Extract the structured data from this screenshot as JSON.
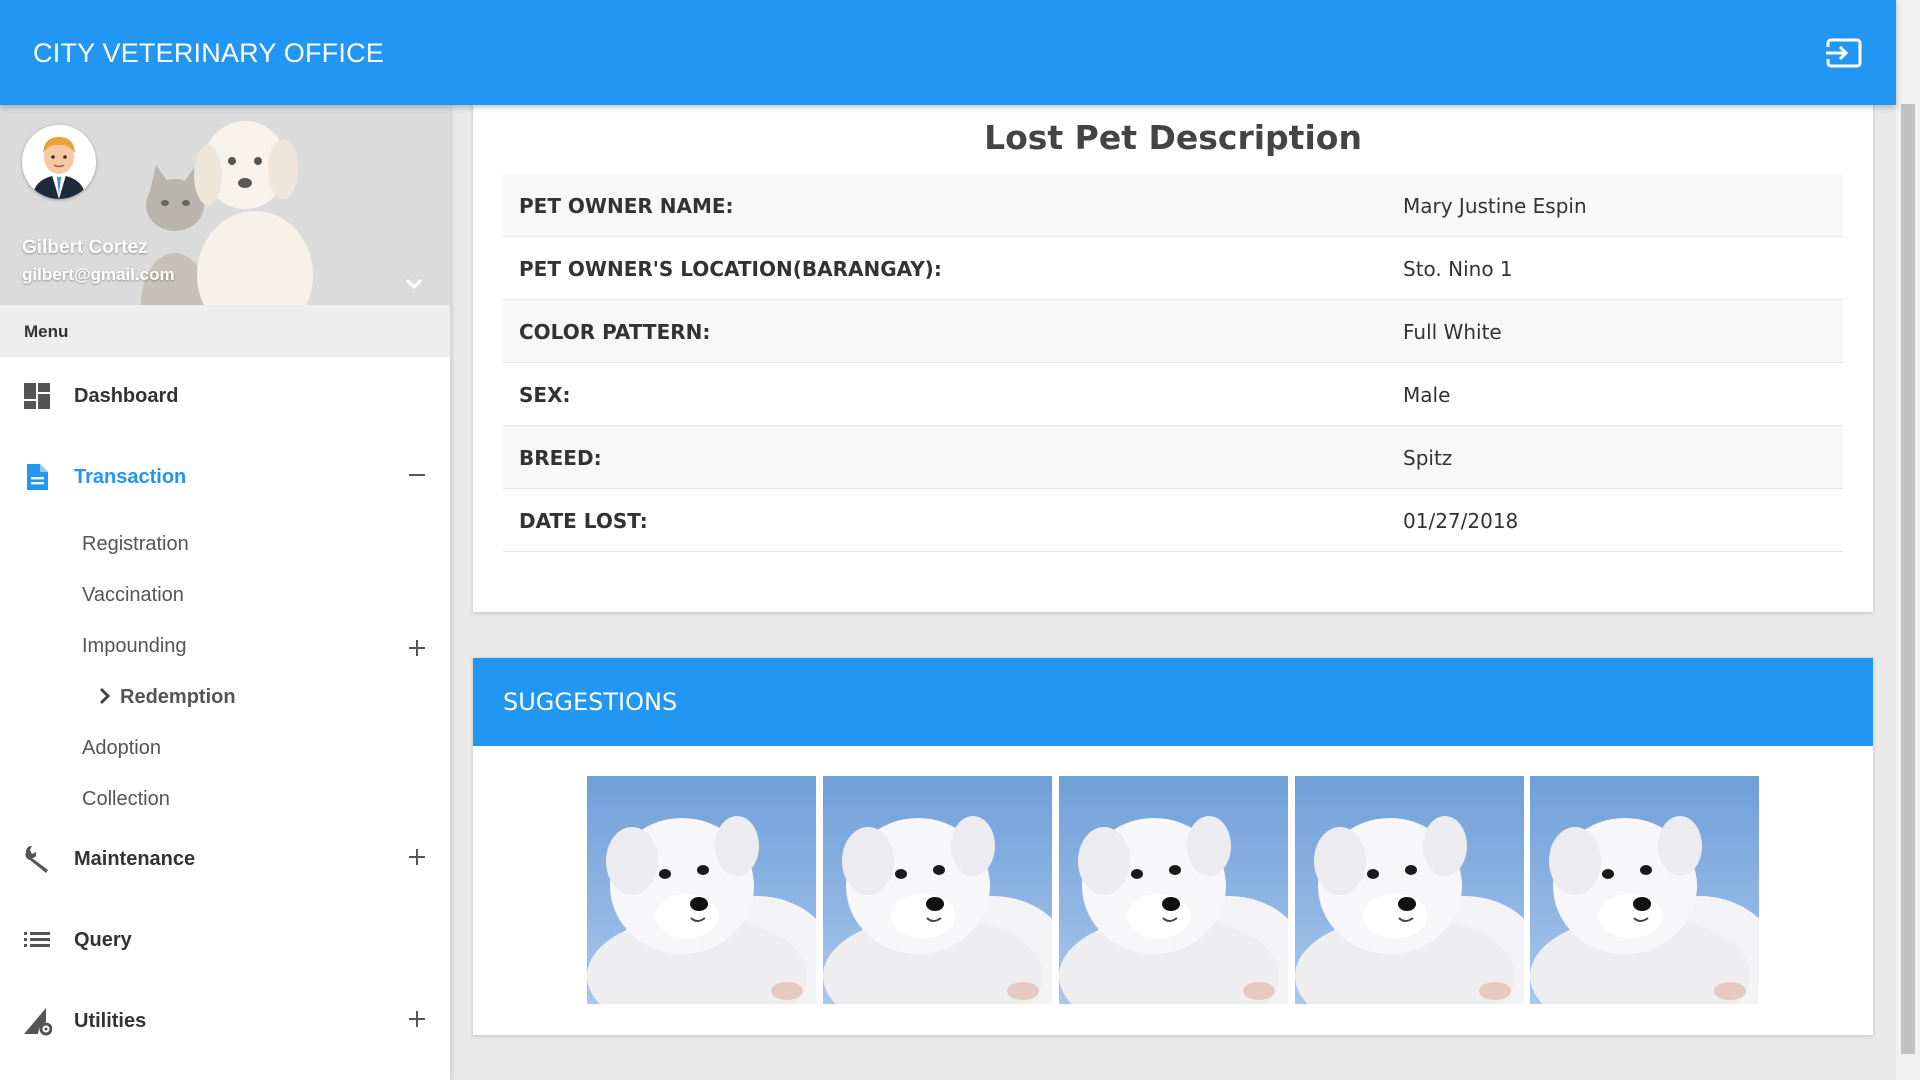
{
  "app": {
    "title": "CITY VETERINARY OFFICE",
    "logout_icon": "exit-to-app-icon"
  },
  "user": {
    "name": "Gilbert Cortez",
    "email": "gilbert@gmail.com"
  },
  "sidebar": {
    "menu_header": "Menu",
    "items": [
      {
        "label": "Dashboard",
        "icon": "dashboard-icon"
      },
      {
        "label": "Transaction",
        "icon": "document-icon",
        "expanded": true,
        "toggle": "−"
      },
      {
        "label": "Maintenance",
        "icon": "wrench-icon",
        "toggle": "+"
      },
      {
        "label": "Query",
        "icon": "list-icon"
      },
      {
        "label": "Utilities",
        "icon": "settings-triangle-icon",
        "toggle": "+"
      }
    ],
    "transaction_sub": [
      {
        "label": "Registration"
      },
      {
        "label": "Vaccination"
      },
      {
        "label": "Impounding",
        "toggle": "+"
      },
      {
        "label": "Adoption"
      },
      {
        "label": "Collection"
      }
    ],
    "impounding_sub": [
      {
        "label": "Redemption"
      }
    ]
  },
  "description": {
    "title": "Lost Pet Description",
    "rows": [
      {
        "label": "PET OWNER NAME:",
        "value": "Mary Justine Espin"
      },
      {
        "label": "PET OWNER'S LOCATION(BARANGAY):",
        "value": "Sto. Nino 1"
      },
      {
        "label": "COLOR PATTERN:",
        "value": "Full White"
      },
      {
        "label": "SEX:",
        "value": "Male"
      },
      {
        "label": "BREED:",
        "value": "Spitz"
      },
      {
        "label": "DATE LOST:",
        "value": "01/27/2018"
      }
    ]
  },
  "suggestions": {
    "title": "SUGGESTIONS",
    "count": 5
  },
  "colors": {
    "primary": "#2196f3",
    "background": "#e9e9e9"
  }
}
